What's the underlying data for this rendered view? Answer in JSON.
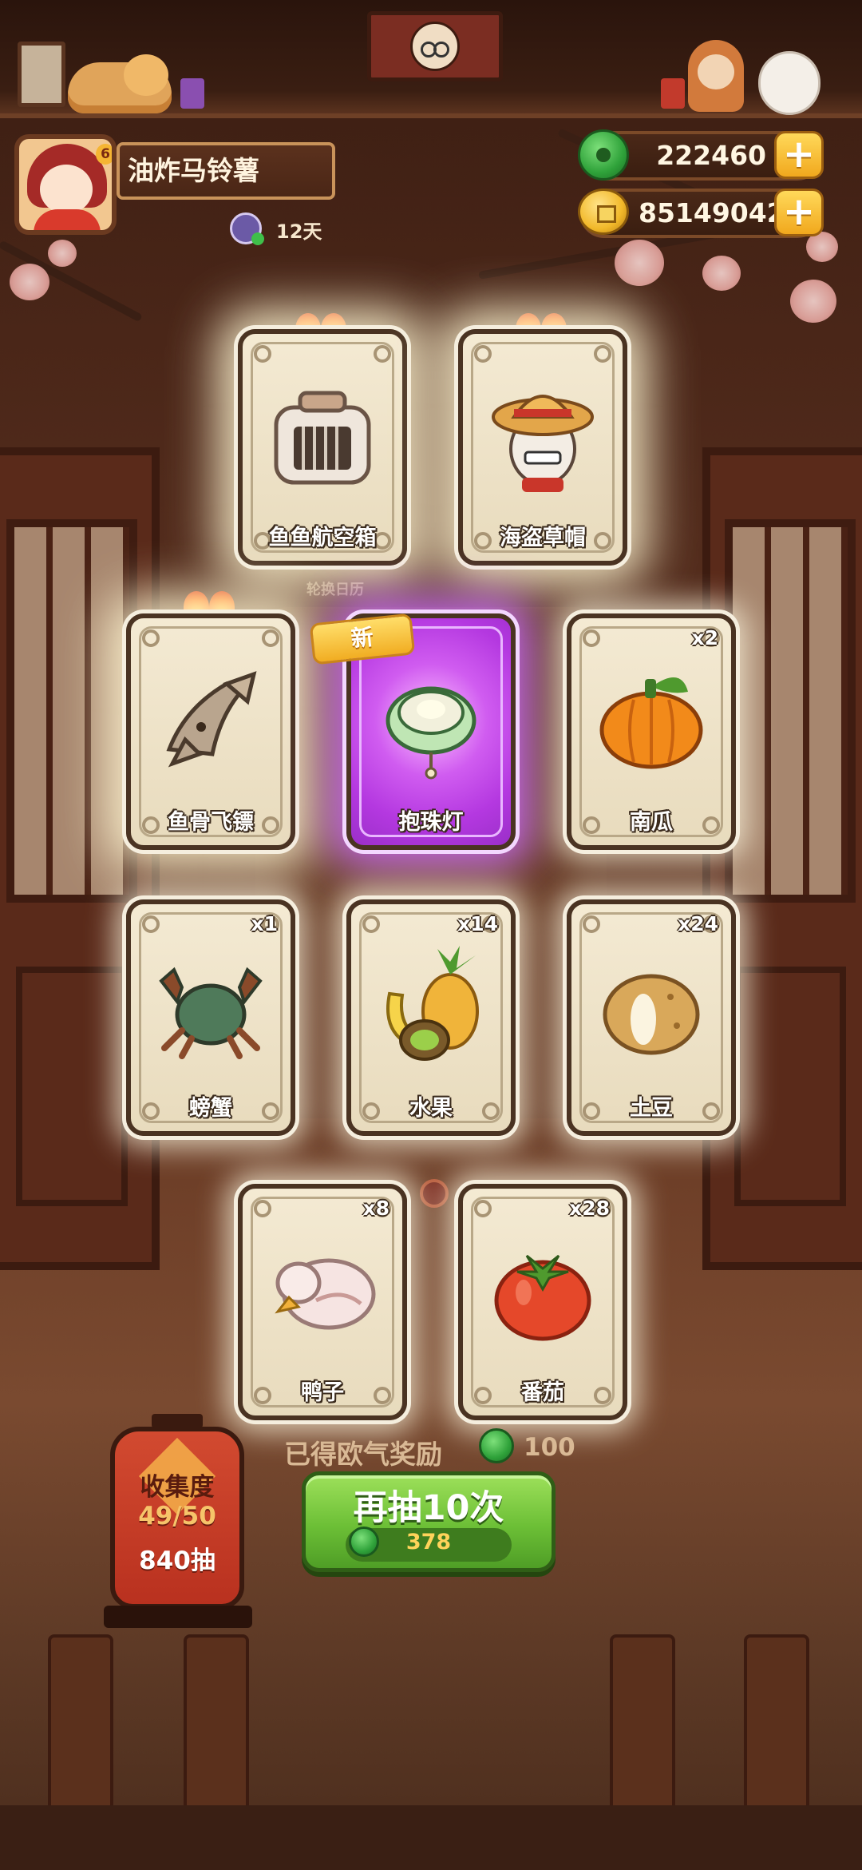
{
  "player": {
    "name": "油炸马铃薯",
    "level_badge": "6",
    "days": "12天"
  },
  "currencies": {
    "jade": {
      "icon": "jade-icon",
      "amount": "222460",
      "add_icon": "plus-icon"
    },
    "coins": {
      "icon": "coin-icon",
      "amount": "85149042",
      "add_icon": "plus-icon"
    }
  },
  "background": {
    "rotate_calendar": "轮换日历"
  },
  "cards": [
    {
      "label": "鱼鱼航空箱",
      "qty": "",
      "rarity": "rare",
      "icon": "pet-carrier-icon"
    },
    {
      "label": "海盗草帽",
      "qty": "",
      "rarity": "rare",
      "icon": "straw-hat-icon"
    },
    {
      "label": "鱼骨飞镖",
      "qty": "",
      "rarity": "rare",
      "icon": "fishbone-dart-icon"
    },
    {
      "label": "抱珠灯",
      "qty": "",
      "rarity": "new",
      "new_badge": "新",
      "icon": "pearl-lamp-icon"
    },
    {
      "label": "南瓜",
      "qty": "x2",
      "rarity": "common",
      "icon": "pumpkin-icon"
    },
    {
      "label": "螃蟹",
      "qty": "x1",
      "rarity": "common",
      "icon": "crab-icon"
    },
    {
      "label": "水果",
      "qty": "x14",
      "rarity": "common",
      "icon": "fruit-icon"
    },
    {
      "label": "土豆",
      "qty": "x24",
      "rarity": "common",
      "icon": "potato-icon"
    },
    {
      "label": "鸭子",
      "qty": "x8",
      "rarity": "common",
      "icon": "duck-icon"
    },
    {
      "label": "番茄",
      "qty": "x28",
      "rarity": "common",
      "icon": "tomato-icon"
    }
  ],
  "reward": {
    "text": "已得欧气奖励",
    "icon": "jade-icon",
    "amount": "100"
  },
  "collection": {
    "title": "收集度",
    "progress": "49/50",
    "pulls": "840抽"
  },
  "draw_button": {
    "label": "再抽10次",
    "cost_icon": "jade-icon",
    "cost": "378"
  },
  "colors": {
    "accent_green": "#6cbf36",
    "new_purple": "#c04ae8",
    "lantern_red": "#c23a24",
    "gold": "#f1ad22"
  }
}
